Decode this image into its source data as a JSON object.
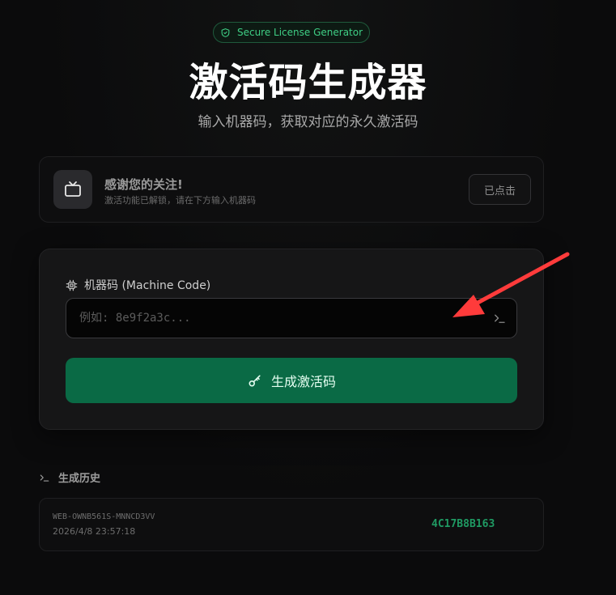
{
  "badge": {
    "text": "Secure License Generator"
  },
  "header": {
    "title": "激活码生成器",
    "subtitle": "输入机器码，获取对应的永久激活码"
  },
  "notice": {
    "title": "感谢您的关注!",
    "description": "激活功能已解锁，请在下方输入机器码",
    "button_label": "已点击"
  },
  "form": {
    "label": "机器码 (Machine Code)",
    "input_value": "",
    "input_placeholder": "例如: 8e9f2a3c...",
    "submit_label": "生成激活码"
  },
  "history": {
    "title": "生成历史",
    "items": [
      {
        "machine_code": "WEB-OWNB561S-MNNCD3VV",
        "timestamp": "2026/4/8 23:57:18",
        "license": "4C17B8B163"
      }
    ]
  },
  "colors": {
    "accent": "#0a6a45",
    "accent_text": "#3fcf85",
    "arrow": "#ff3b3b"
  },
  "icons": {
    "badge": "shield-check-icon",
    "notice": "tv-icon",
    "field": "cpu-chip-icon",
    "input_suffix": "terminal-icon",
    "submit": "key-icon",
    "history": "terminal-icon"
  }
}
